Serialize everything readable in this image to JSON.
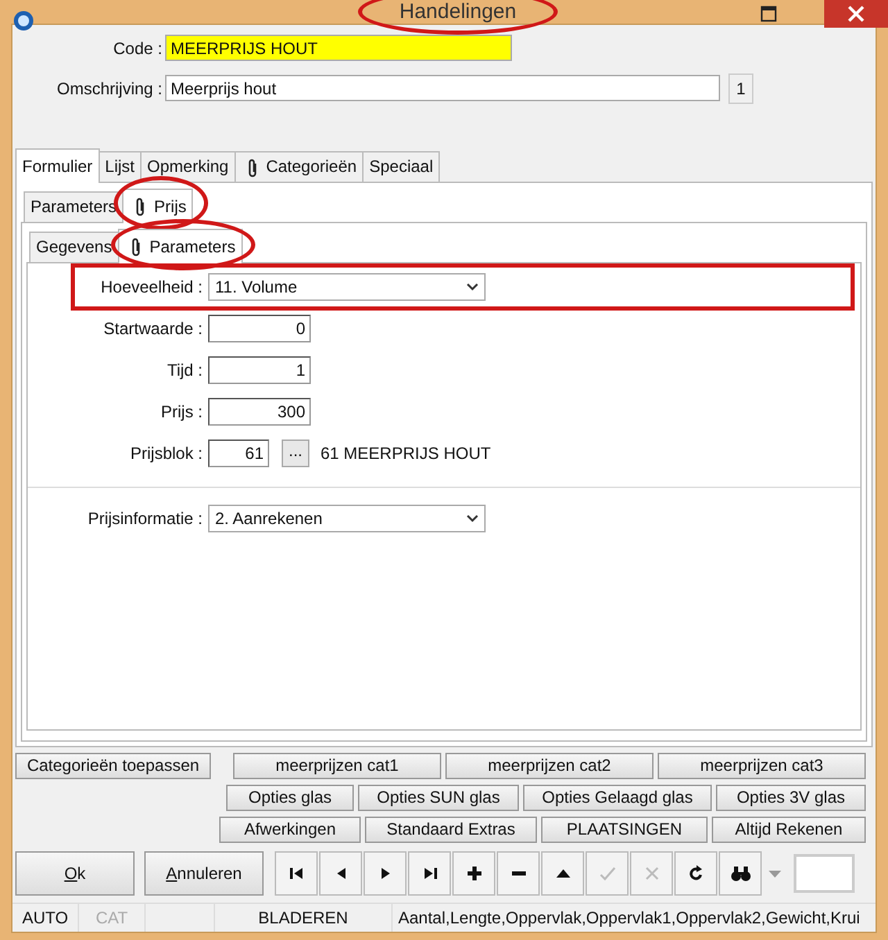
{
  "window": {
    "title": "Handelingen",
    "highlighted": true
  },
  "fields": [
    {
      "kind": "code",
      "label": "Code :",
      "value": "MEERPRIJS HOUT"
    },
    {
      "kind": "text",
      "label": "Omschrijving :",
      "value": "Meerprijs hout",
      "counter": "1"
    }
  ],
  "tabs": [
    {
      "label": "Formulier",
      "selected": true,
      "clip": false
    },
    {
      "label": "Lijst",
      "selected": false,
      "clip": false
    },
    {
      "label": "Opmerking",
      "selected": false,
      "clip": false
    },
    {
      "label": "Categorieën",
      "selected": false,
      "clip": true
    },
    {
      "label": "Speciaal",
      "selected": false,
      "clip": false
    }
  ],
  "subtabs": [
    {
      "label": "Parameters",
      "selected": false,
      "clip": false,
      "highlighted": false
    },
    {
      "label": "Prijs",
      "selected": true,
      "clip": true,
      "highlighted": true
    }
  ],
  "inner_tabs": [
    {
      "label": "Gegevens",
      "selected": false,
      "clip": false,
      "highlighted": false
    },
    {
      "label": "Parameters",
      "selected": true,
      "clip": true,
      "highlighted": true
    }
  ],
  "price_fields": [
    {
      "kind": "select",
      "label": "Hoeveelheid :",
      "value": "11. Volume",
      "highlighted": true
    },
    {
      "kind": "number",
      "label": "Startwaarde :",
      "value": "0",
      "highlighted": false
    },
    {
      "kind": "number",
      "label": "Tijd :",
      "value": "1",
      "highlighted": false
    },
    {
      "kind": "number",
      "label": "Prijs :",
      "value": "300",
      "highlighted": false
    },
    {
      "kind": "lookup",
      "label": "Prijsblok :",
      "value": "61",
      "button": "...",
      "description": "61 MEERPRIJS HOUT",
      "highlighted": false
    }
  ],
  "info_fields": [
    {
      "kind": "select",
      "label": "Prijsinformatie :",
      "value": "2.  Aanrekenen",
      "highlighted": false
    }
  ],
  "category_button": "Categorieën toepassen",
  "button_rows": [
    [
      "meerprijzen cat1",
      "meerprijzen cat2",
      "meerprijzen cat3"
    ],
    [
      "Opties glas",
      "Opties SUN glas",
      "Opties Gelaagd glas",
      "Opties 3V glas"
    ],
    [
      "Afwerkingen",
      "Standaard Extras",
      "PLAATSINGEN",
      "Altijd Rekenen"
    ]
  ],
  "actions": [
    "Ok",
    "Annuleren"
  ],
  "toolbar": [
    {
      "kind": "first",
      "disabled": false
    },
    {
      "kind": "prev",
      "disabled": false
    },
    {
      "kind": "next",
      "disabled": false
    },
    {
      "kind": "last",
      "disabled": false
    },
    {
      "kind": "add",
      "disabled": false
    },
    {
      "kind": "remove",
      "disabled": false
    },
    {
      "kind": "up",
      "disabled": false
    },
    {
      "kind": "confirm",
      "disabled": true
    },
    {
      "kind": "cancel",
      "disabled": true
    },
    {
      "kind": "refresh",
      "disabled": false
    },
    {
      "kind": "find",
      "disabled": false
    }
  ],
  "status_bar": [
    {
      "text": "AUTO",
      "disabled": false
    },
    {
      "text": "CAT",
      "disabled": true
    },
    {
      "text": "BLADEREN",
      "disabled": false
    },
    {
      "text": "Aantal,Lengte,Oppervlak,Oppervlak1,Oppervlak2,Gewicht,Krui",
      "disabled": false
    }
  ]
}
